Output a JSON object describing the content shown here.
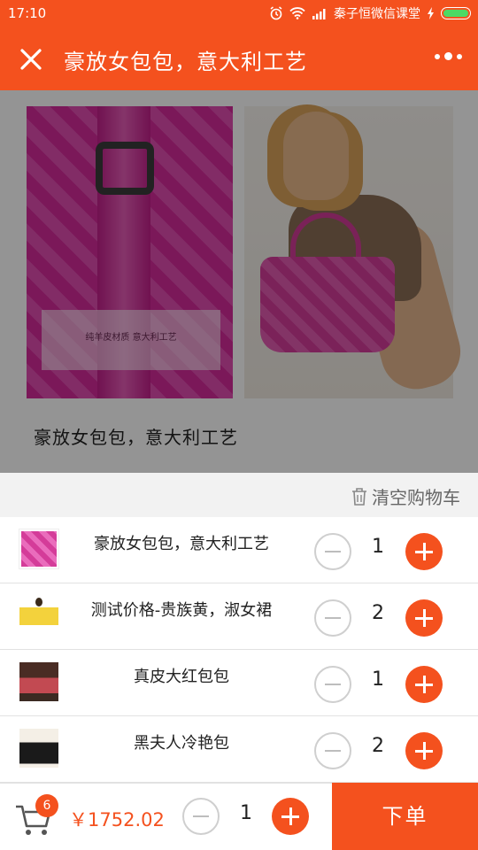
{
  "status_bar": {
    "time": "17:10",
    "carrier": "秦子恒微信课堂"
  },
  "navbar": {
    "title": "豪放女包包，意大利工艺",
    "close_icon": "close-icon",
    "more_icon": "more-icon"
  },
  "product": {
    "image_caption": "纯羊皮材质  意大利工艺",
    "title": "豪放女包包，意大利工艺"
  },
  "cart": {
    "clear_label": "清空购物车",
    "items": [
      {
        "name": "豪放女包包，意大利工艺",
        "qty": "1",
        "thumb": "pink-bag"
      },
      {
        "name": "测试价格-贵族黄，淑女裙",
        "qty": "2",
        "thumb": "yellow-dress"
      },
      {
        "name": "真皮大红包包",
        "qty": "1",
        "thumb": "red-bag"
      },
      {
        "name": "黑夫人冷艳包",
        "qty": "2",
        "thumb": "black-bag"
      }
    ]
  },
  "bottom_bar": {
    "badge_count": "6",
    "total_price": "￥1752.02",
    "qty": "1",
    "order_label": "下单"
  },
  "colors": {
    "accent": "#f4511e",
    "battery": "#4cd964"
  }
}
